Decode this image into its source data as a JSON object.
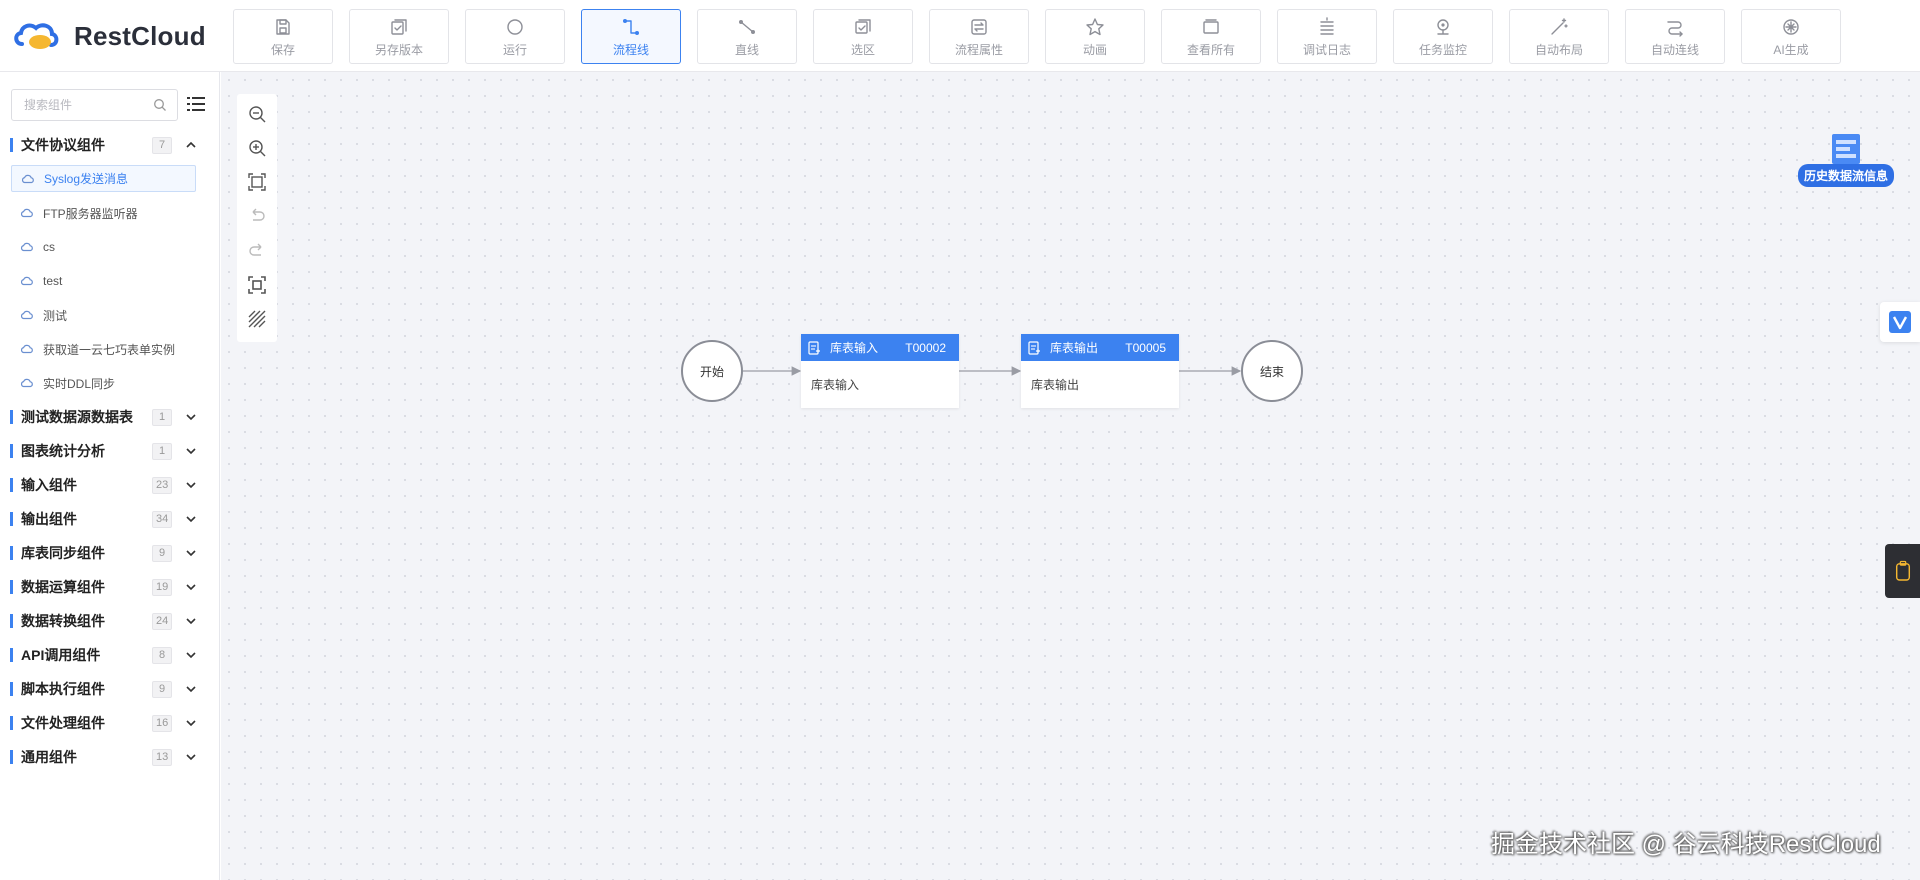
{
  "brand": {
    "name": "RestCloud"
  },
  "toolbar": [
    {
      "key": "save",
      "label": "保存",
      "icon": "save-icon",
      "active": false
    },
    {
      "key": "save-version",
      "label": "另存版本",
      "icon": "save-version-icon",
      "active": false
    },
    {
      "key": "run",
      "label": "运行",
      "icon": "run-icon",
      "active": false
    },
    {
      "key": "flow-line",
      "label": "流程线",
      "icon": "flow-line-icon",
      "active": true
    },
    {
      "key": "straight-line",
      "label": "直线",
      "icon": "straight-line-icon",
      "active": false
    },
    {
      "key": "select-area",
      "label": "选区",
      "icon": "select-area-icon",
      "active": false
    },
    {
      "key": "flow-props",
      "label": "流程属性",
      "icon": "flow-props-icon",
      "active": false
    },
    {
      "key": "animation",
      "label": "动画",
      "icon": "star-icon",
      "active": false
    },
    {
      "key": "view-all",
      "label": "查看所有",
      "icon": "view-all-icon",
      "active": false
    },
    {
      "key": "debug-log",
      "label": "调试日志",
      "icon": "debug-log-icon",
      "active": false
    },
    {
      "key": "task-monitor",
      "label": "任务监控",
      "icon": "monitor-icon",
      "active": false
    },
    {
      "key": "auto-layout",
      "label": "自动布局",
      "icon": "magic-wand-icon",
      "active": false
    },
    {
      "key": "auto-connect",
      "label": "自动连线",
      "icon": "auto-connect-icon",
      "active": false
    },
    {
      "key": "ai-generate",
      "label": "AI生成",
      "icon": "ai-icon",
      "active": false
    }
  ],
  "sidebar": {
    "search_placeholder": "搜索组件",
    "groups": [
      {
        "name": "文件协议组件",
        "count": "7",
        "expanded": true,
        "items": [
          {
            "label": "Syslog发送消息",
            "active": true
          },
          {
            "label": "FTP服务器监听器",
            "active": false
          },
          {
            "label": "cs",
            "active": false
          },
          {
            "label": "test",
            "active": false
          },
          {
            "label": "测试",
            "active": false
          },
          {
            "label": "获取道一云七巧表单实例",
            "active": false
          },
          {
            "label": "实时DDL同步",
            "active": false
          }
        ]
      },
      {
        "name": "测试数据源数据表",
        "count": "1",
        "expanded": false,
        "items": []
      },
      {
        "name": "图表统计分析",
        "count": "1",
        "expanded": false,
        "items": []
      },
      {
        "name": "输入组件",
        "count": "23",
        "expanded": false,
        "items": []
      },
      {
        "name": "输出组件",
        "count": "34",
        "expanded": false,
        "items": []
      },
      {
        "name": "库表同步组件",
        "count": "9",
        "expanded": false,
        "items": []
      },
      {
        "name": "数据运算组件",
        "count": "19",
        "expanded": false,
        "items": []
      },
      {
        "name": "数据转换组件",
        "count": "24",
        "expanded": false,
        "items": []
      },
      {
        "name": "API调用组件",
        "count": "8",
        "expanded": false,
        "items": []
      },
      {
        "name": "脚本执行组件",
        "count": "9",
        "expanded": false,
        "items": []
      },
      {
        "name": "文件处理组件",
        "count": "16",
        "expanded": false,
        "items": []
      },
      {
        "name": "通用组件",
        "count": "13",
        "expanded": false,
        "items": []
      }
    ]
  },
  "canvas_controls": [
    "zoom-out-icon",
    "zoom-in-icon",
    "fit-view-icon",
    "undo-icon",
    "redo-icon",
    "fullscreen-icon",
    "grid-pattern-icon"
  ],
  "flow": {
    "start": {
      "label": "开始"
    },
    "task1": {
      "name": "库表输入",
      "id": "T00002",
      "desc": "库表输入"
    },
    "task2": {
      "name": "库表输出",
      "id": "T00005",
      "desc": "库表输出"
    },
    "end": {
      "label": "结束"
    }
  },
  "history_button": {
    "label": "历史数据流信息"
  },
  "watermark": {
    "text": "掘金技术社区 @ 谷云科技RestCloud"
  },
  "colors": {
    "accent": "#3c82f0",
    "canvas_bg": "#f3f4f8"
  }
}
